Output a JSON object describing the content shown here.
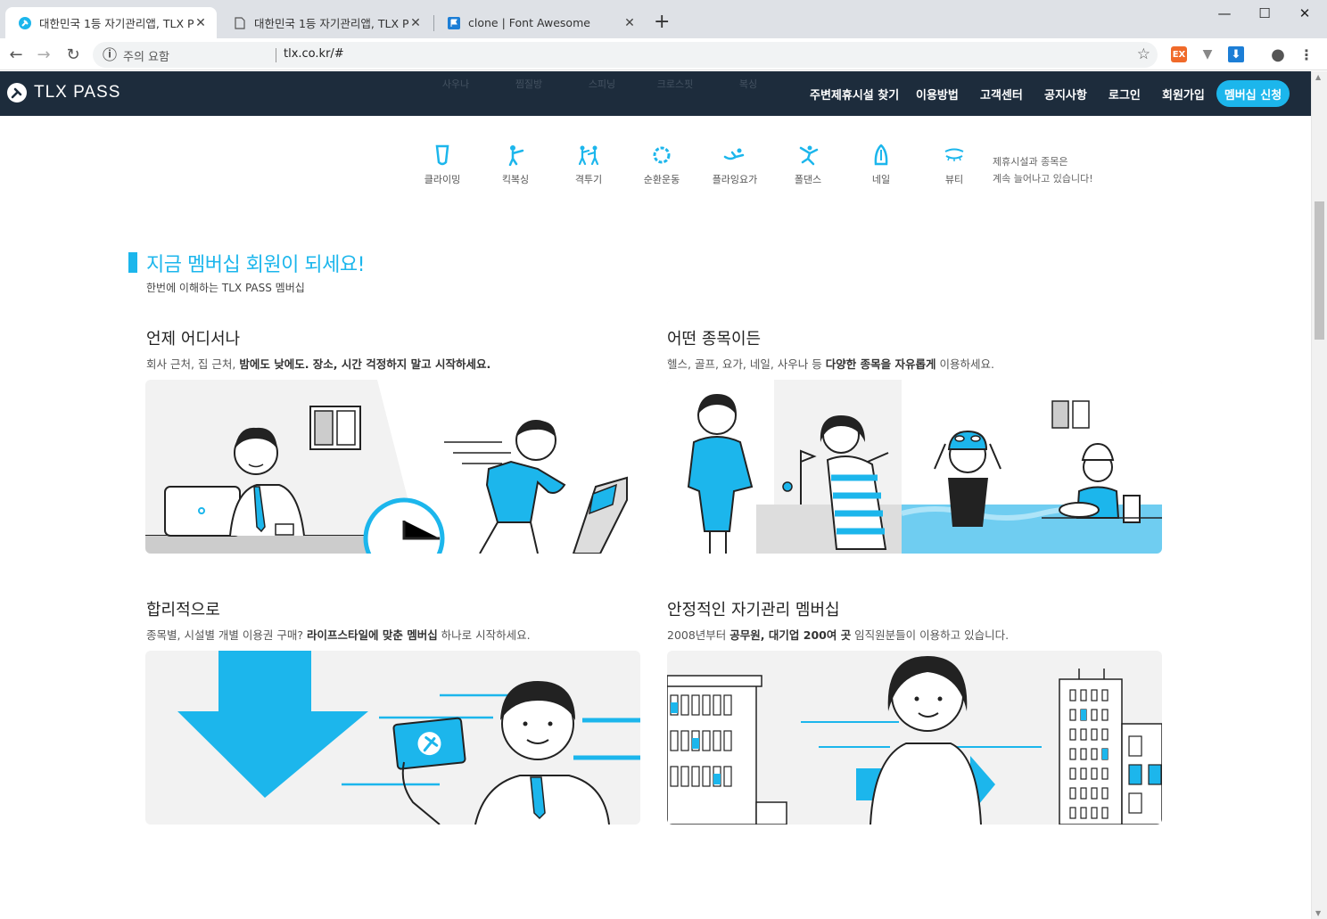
{
  "browser": {
    "tabs": [
      {
        "title": "대한민국 1등 자기관리앱, TLX P..."
      },
      {
        "title": "대한민국 1등 자기관리앱, TLX P..."
      },
      {
        "title": "clone | Font Awesome"
      }
    ],
    "address": {
      "security_label": "주의 요함",
      "url": "tlx.co.kr/#"
    },
    "extensions": {
      "ex_label": "EX"
    }
  },
  "site": {
    "logo_text": "TLX PASS",
    "ghost_categories": [
      "사우나",
      "찜질방",
      "스피닝",
      "크로스핏",
      "복싱"
    ],
    "menu": [
      {
        "label": "주변제휴시설 찾기"
      },
      {
        "label": "이용방법"
      },
      {
        "label": "고객센터"
      },
      {
        "label": "공지사항"
      },
      {
        "label": "로그인"
      },
      {
        "label": "회원가입"
      }
    ],
    "apply_button": "멤버십 신청"
  },
  "categories": [
    {
      "label": "클라이밍",
      "icon": "climbing-icon"
    },
    {
      "label": "킥복싱",
      "icon": "kickboxing-icon"
    },
    {
      "label": "격투기",
      "icon": "martial-arts-icon"
    },
    {
      "label": "순환운동",
      "icon": "circuit-training-icon"
    },
    {
      "label": "플라잉요가",
      "icon": "flying-yoga-icon"
    },
    {
      "label": "폴댄스",
      "icon": "pole-dance-icon"
    },
    {
      "label": "네일",
      "icon": "nail-icon"
    },
    {
      "label": "뷰티",
      "icon": "beauty-icon"
    }
  ],
  "categories_note": [
    "제휴시설과 종목은",
    "계속 늘어나고 있습니다!"
  ],
  "section": {
    "title": "지금 멤버십 회원이 되세요!",
    "subtitle": "한번에 이해하는 TLX PASS 멤버십"
  },
  "cards": [
    {
      "title": "언제 어디서나",
      "desc_plain1": "회사 근처, 집 근처, ",
      "desc_bold": "밤에도 낮에도. 장소, 시간 걱정하지 말고 시작하세요.",
      "desc_plain2": ""
    },
    {
      "title": "어떤 종목이든",
      "desc_plain1": "헬스, 골프, 요가, 네일, 사우나 등 ",
      "desc_bold": "다양한 종목을 자유롭게",
      "desc_plain2": " 이용하세요."
    },
    {
      "title": "합리적으로",
      "desc_plain1": "종목별, 시설별 개별 이용권 구매? ",
      "desc_bold": "라이프스타일에 맞춘 멤버십",
      "desc_plain2": " 하나로 시작하세요."
    },
    {
      "title": "안정적인 자기관리 멤버십",
      "desc_plain1": "2008년부터 ",
      "desc_bold": "공무원, 대기업 200여 곳",
      "desc_plain2": " 임직원분들이 이용하고 있습니다."
    }
  ],
  "colors": {
    "brand": "#1cb6ec",
    "header_bg": "#1d2c3c"
  }
}
